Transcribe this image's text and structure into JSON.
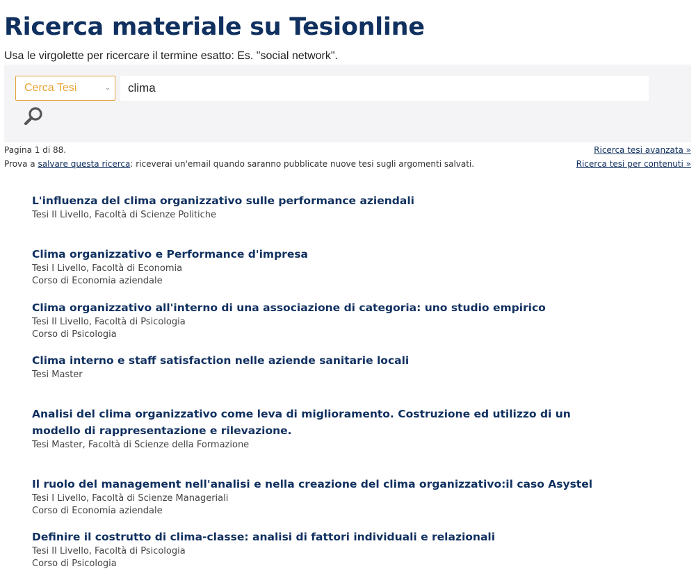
{
  "header": {
    "title": "Ricerca materiale su Tesionline",
    "hint": "Usa le virgolette per ricercare il termine esatto: Es. \"social network\"."
  },
  "search": {
    "type_selected": "Cerca Tesi",
    "query": "clima",
    "button_icon": "search-icon"
  },
  "meta": {
    "pagination": "Pagina 1 di 88.",
    "save_prefix": "Prova a ",
    "save_link": "salvare questa ricerca",
    "save_suffix": ": riceverai un'email quando saranno pubblicate nuove tesi sugli argomenti salvati.",
    "advanced_link": "Ricerca tesi avanzata »",
    "content_link": "Ricerca tesi per contenuti »"
  },
  "results": [
    {
      "title": "L'influenza del clima organizzativo sulle performance aziendali",
      "info1": "Tesi II Livello, Facoltà di Scienze Politiche",
      "info2": ""
    },
    {
      "title": "Clima organizzativo e Performance d'impresa",
      "info1": "Tesi I Livello, Facoltà di Economia",
      "info2": "Corso di Economia aziendale"
    },
    {
      "title": "Clima organizzativo all'interno di una associazione di categoria: uno studio empirico",
      "info1": "Tesi II Livello, Facoltà di Psicologia",
      "info2": "Corso di Psicologia"
    },
    {
      "title": "Clima interno e staff satisfaction nelle aziende sanitarie locali",
      "info1": "Tesi Master",
      "info2": ""
    },
    {
      "title": "Analisi del clima organizzativo come leva di miglioramento. Costruzione ed utilizzo di un modello di rappresentazione e rilevazione.",
      "info1": "Tesi Master, Facoltà di Scienze della Formazione",
      "info2": ""
    },
    {
      "title": "Il ruolo del management nell'analisi e nella creazione del clima organizzativo:il caso Asystel",
      "info1": "Tesi I Livello, Facoltà di Scienze Manageriali",
      "info2": "Corso di Economia aziendale"
    },
    {
      "title": "Definire il costrutto di clima-classe: analisi di fattori individuali e relazionali",
      "info1": "Tesi II Livello, Facoltà di Psicologia",
      "info2": "Corso di Psicologia"
    }
  ],
  "colors": {
    "title": "#10305f",
    "select_accent": "#e8a331",
    "panel_bg": "#f4f4f6"
  }
}
